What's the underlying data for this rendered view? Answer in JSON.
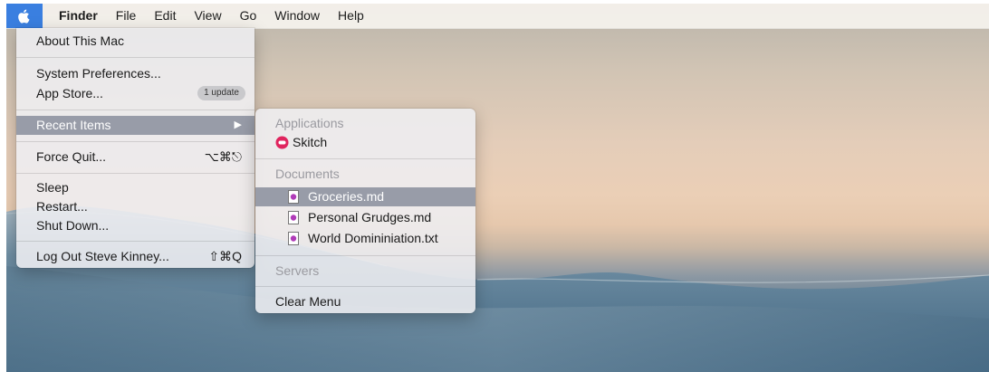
{
  "menubar": {
    "apple_icon": "apple-logo-icon",
    "items": [
      "Finder",
      "File",
      "Edit",
      "View",
      "Go",
      "Window",
      "Help"
    ]
  },
  "apple_menu": {
    "about": "About This Mac",
    "system_preferences": "System Preferences...",
    "app_store": "App Store...",
    "app_store_badge": "1 update",
    "recent_items": "Recent Items",
    "force_quit": "Force Quit...",
    "force_quit_shortcut": "⌥⌘⎋",
    "sleep": "Sleep",
    "restart": "Restart...",
    "shut_down": "Shut Down...",
    "log_out": "Log Out Steve Kinney...",
    "log_out_shortcut": "⇧⌘Q"
  },
  "recent_items_menu": {
    "applications_header": "Applications",
    "applications": [
      "Skitch"
    ],
    "documents_header": "Documents",
    "documents": [
      "Groceries.md",
      "Personal Grudges.md",
      "World Domininiation.txt"
    ],
    "servers_header": "Servers",
    "clear_menu": "Clear Menu"
  },
  "colors": {
    "menubar_highlight": "#3a7fe0",
    "selection": "#989ca8",
    "skitch_icon": "#e0245e",
    "doc_icon": "#b03bb8"
  }
}
